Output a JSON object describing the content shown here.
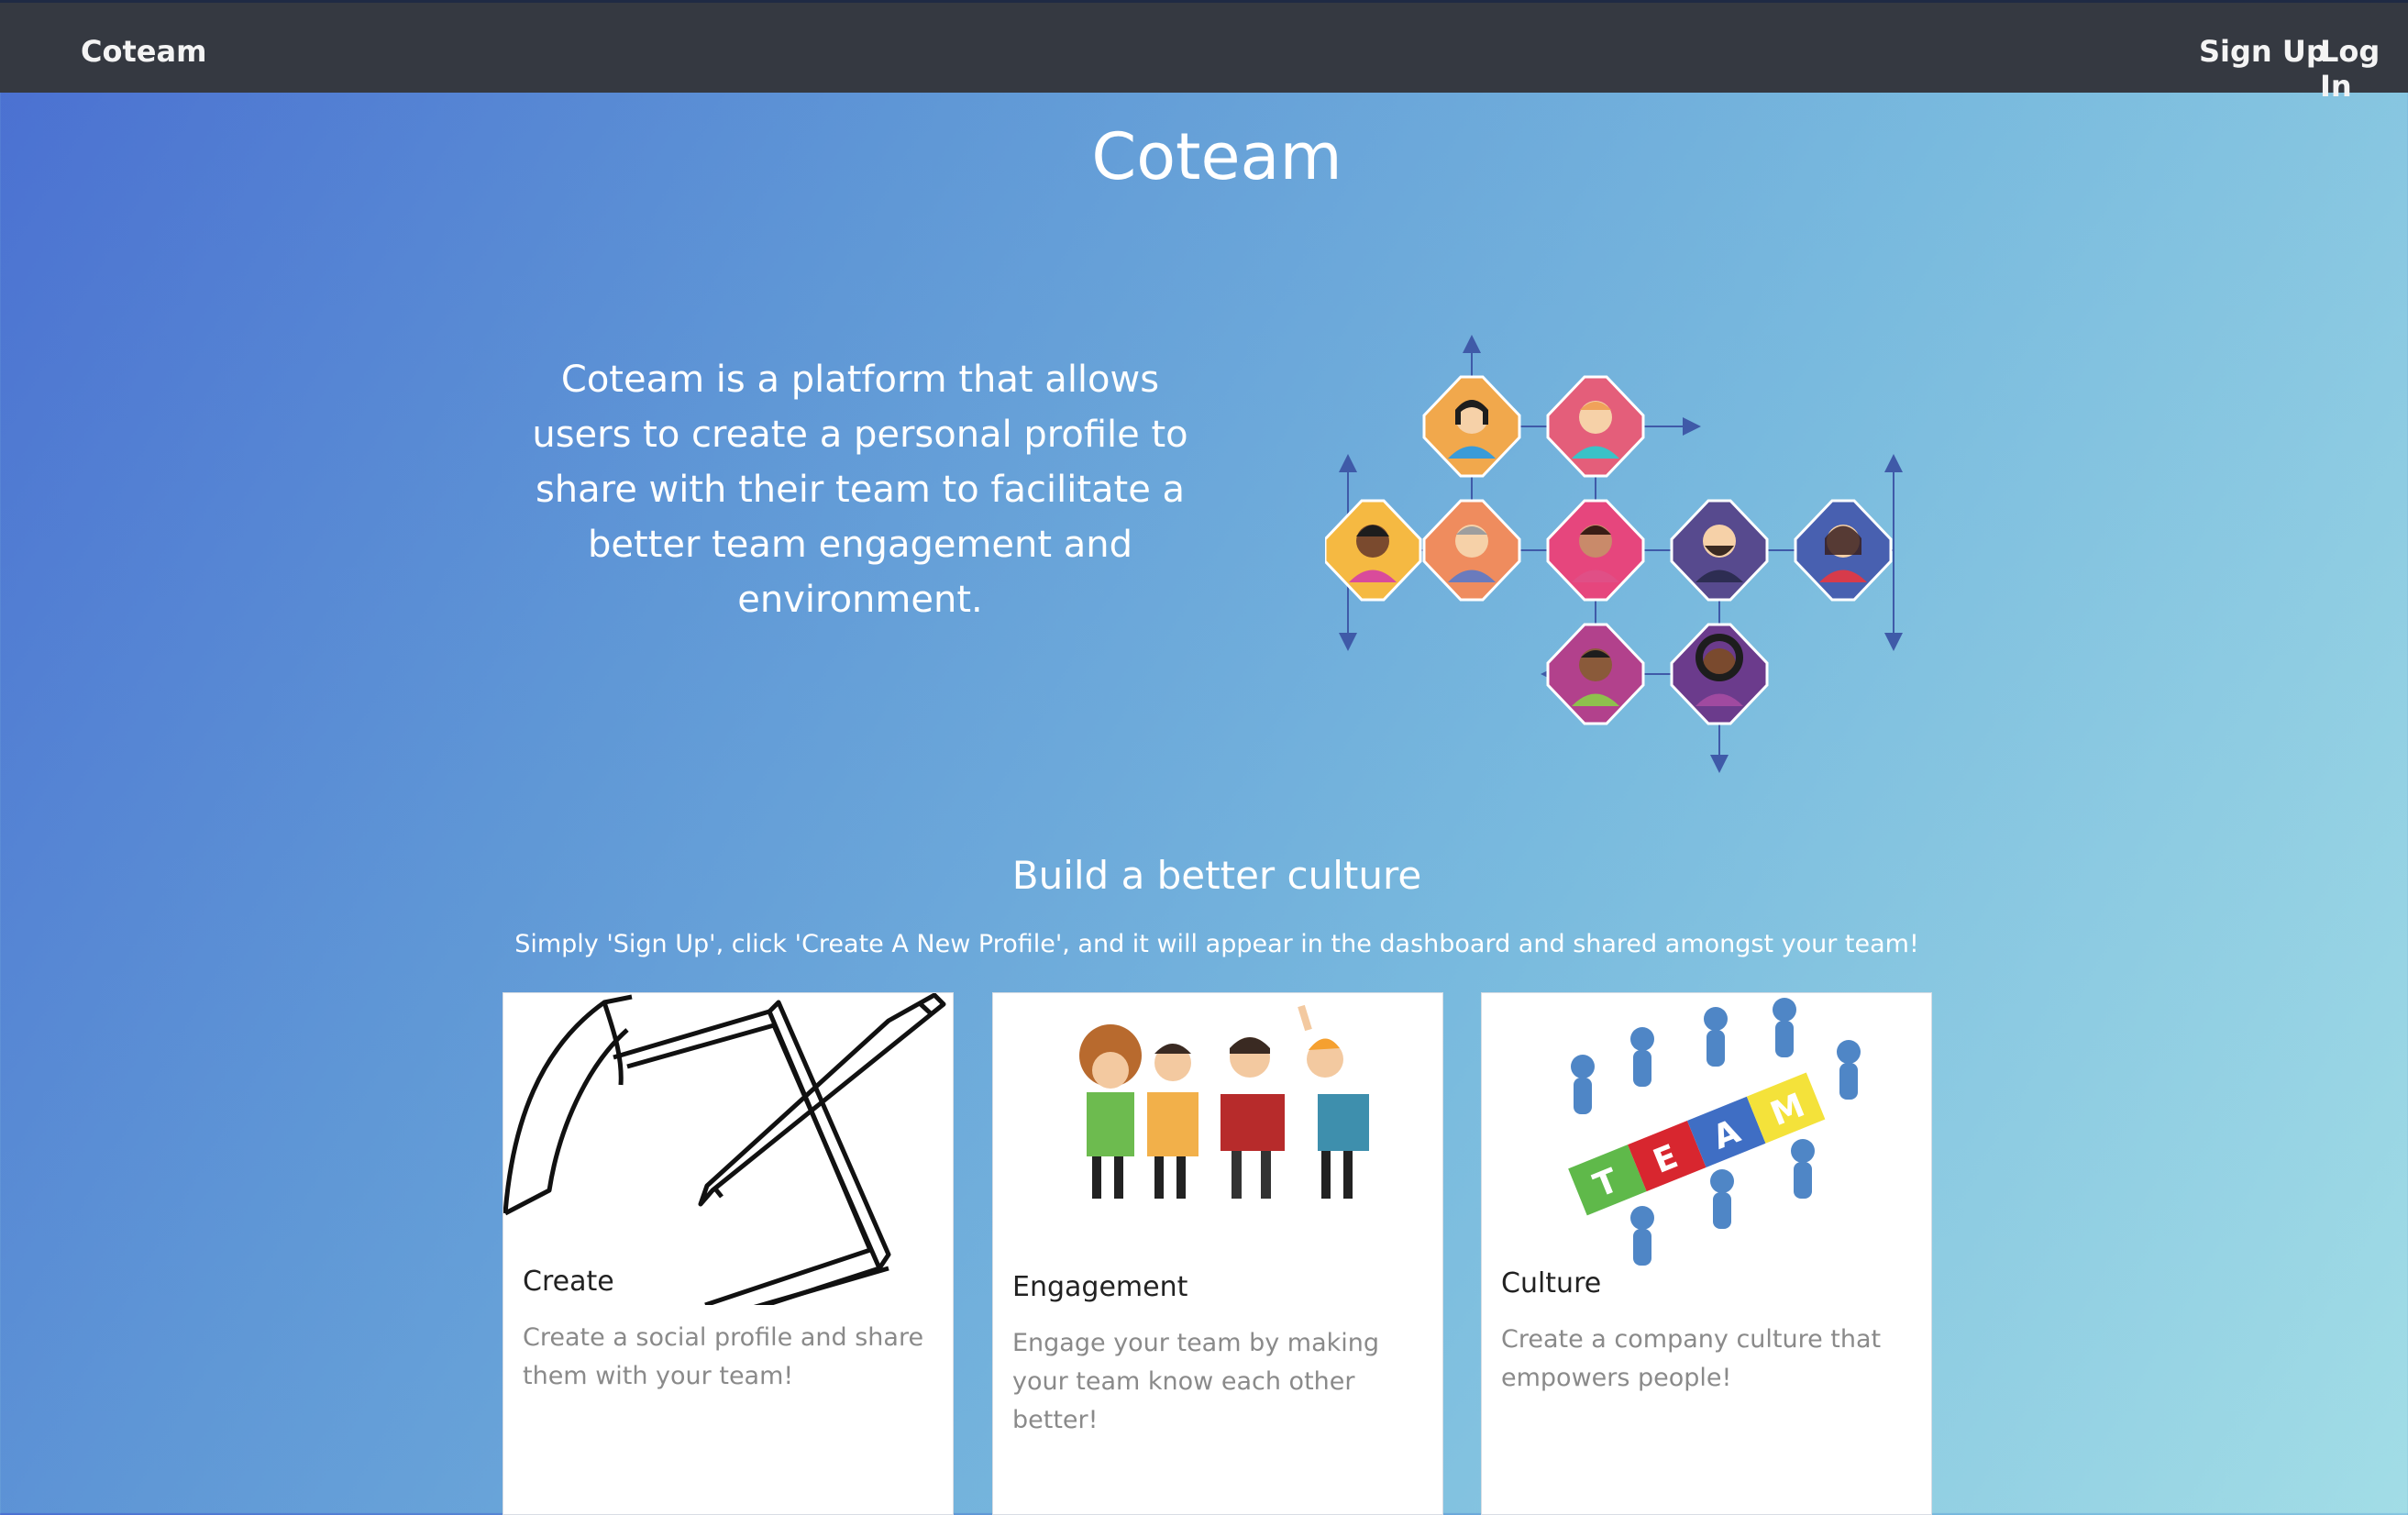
{
  "navbar": {
    "brand": "Coteam",
    "links": {
      "signup": "Sign Up",
      "login": "Log In"
    }
  },
  "hero": {
    "title": "Coteam",
    "description": "Coteam is a platform that allows users to create a personal profile to share with their team to facilitate a better team engagement and environment."
  },
  "section": {
    "title": "Build a better culture",
    "subtitle": "Simply 'Sign Up', click 'Create A New Profile', and it will appear in the dashboard and shared amongst your team!"
  },
  "cards": [
    {
      "title": "Create",
      "text": "Create a social profile and share them with your team!",
      "icon": "notebook-pencil-sketch"
    },
    {
      "title": "Engagement",
      "text": "Engage your team by making your team know each other better!",
      "icon": "people-puzzle-pieces"
    },
    {
      "title": "Culture",
      "text": "Create a company culture that empowers people!",
      "icon": "team-puzzle-figures"
    }
  ],
  "colors": {
    "navbar": "#353941",
    "gradient_start": "#4a6fd1",
    "gradient_end": "#a2dde6",
    "network_arrow": "#3f5aa8"
  }
}
